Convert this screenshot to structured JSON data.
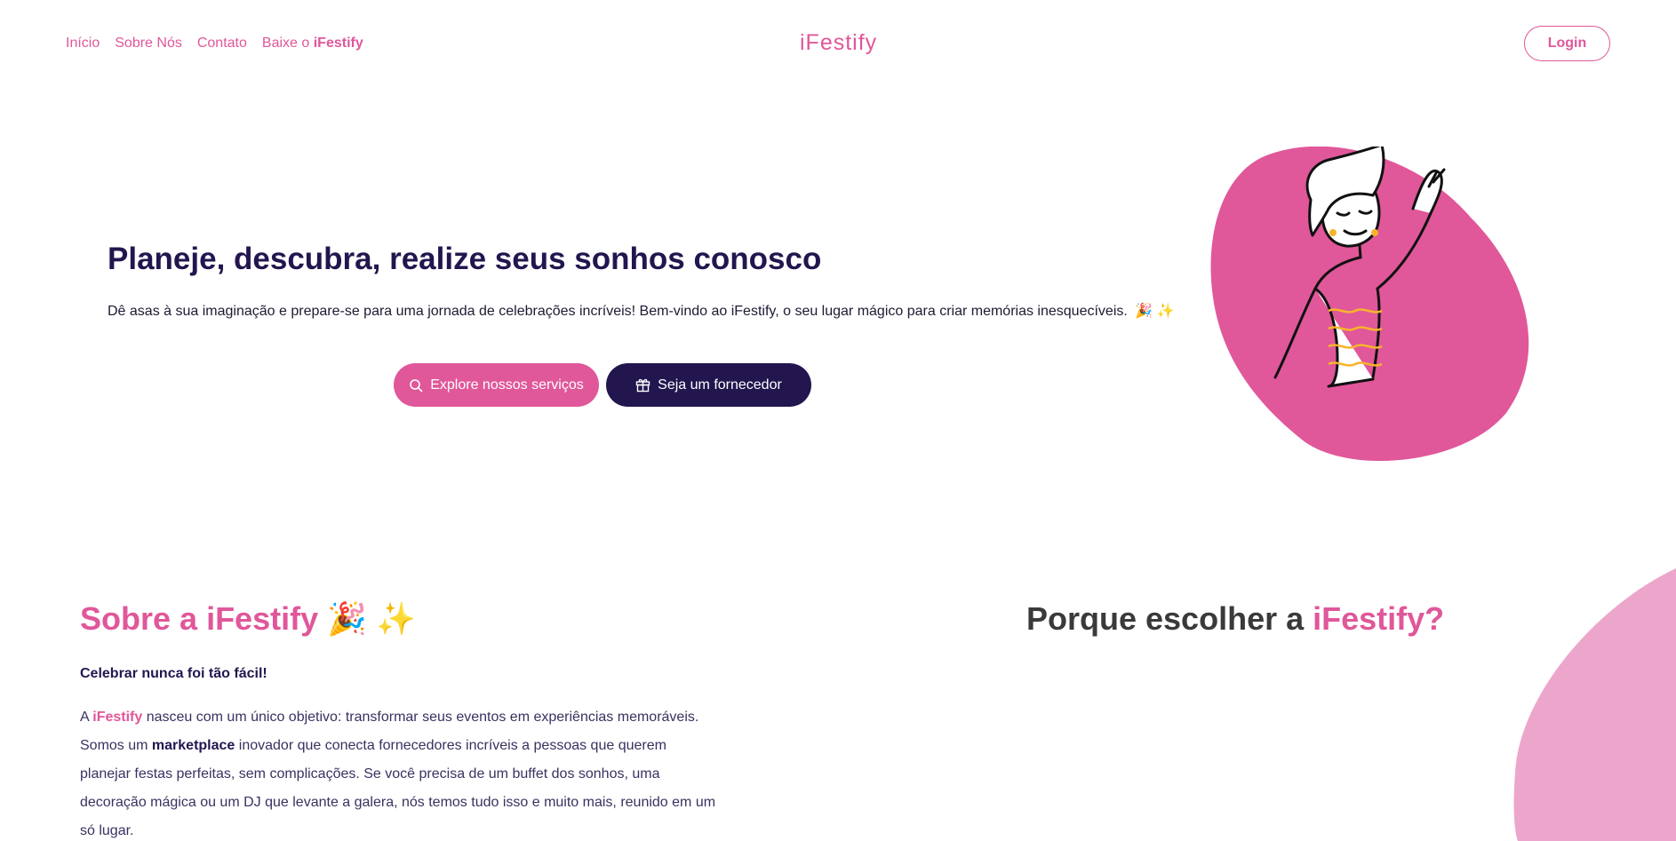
{
  "nav": {
    "links": [
      "Início",
      "Sobre Nós",
      "Contato"
    ],
    "download_prefix": "Baixe o",
    "download_brand": "iFestify",
    "brand": "iFestify",
    "login_label": "Login"
  },
  "hero": {
    "title": "Planeje, descubra, realize seus sonhos conosco",
    "subtitle": "Dê asas à sua imaginação e prepare-se para uma jornada de celebrações incríveis! Bem-vindo ao iFestify, o seu lugar mágico para criar memórias inesquecíveis.",
    "subtitle_emoji": "🎉 ✨",
    "explore_label": "Explore nossos serviços",
    "supplier_label": "Seja um fornecedor"
  },
  "about": {
    "title_prefix": "Sobre a",
    "title_brand": "iFestify",
    "title_emoji": "🎉 ✨",
    "tagline": "Celebrar nunca foi tão fácil!",
    "p_a": "A",
    "p_brand": "iFestify",
    "p_1": "nasceu com um único objetivo: transformar seus eventos em experiências memoráveis. Somos um",
    "p_marketplace": "marketplace",
    "p_2": "inovador que conecta fornecedores incríveis a pessoas que querem planejar festas perfeitas, sem complicações. Se você precisa de um buffet dos sonhos, uma decoração mágica ou um DJ que levante a galera, nós temos tudo isso e muito mais, reunido em um só lugar."
  },
  "why": {
    "title_prefix": "Porque escolher a",
    "title_brand": "iFestify?"
  },
  "colors": {
    "pink": "#e0579a",
    "navy": "#23164f",
    "light_pink": "#eda6cb"
  },
  "icons": {
    "explore": "search-icon",
    "supplier": "gift-icon"
  }
}
